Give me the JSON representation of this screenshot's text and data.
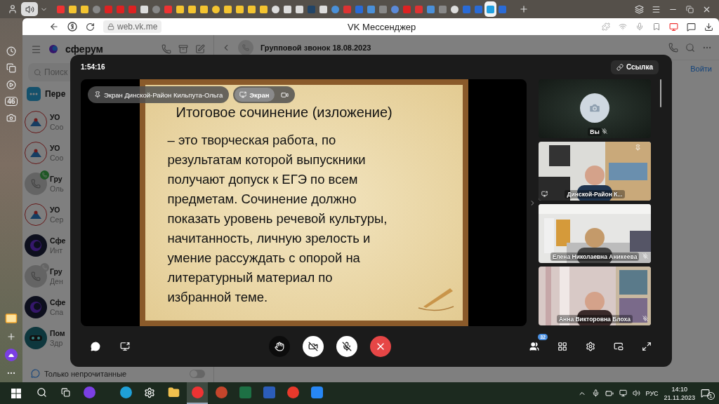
{
  "browser": {
    "tabs": [
      {
        "selected": false
      },
      {
        "selected": false
      },
      {
        "selected": false
      },
      {
        "selected": false
      },
      {
        "selected": false
      },
      {
        "selected": false
      },
      {
        "selected": false
      },
      {
        "selected": false
      },
      {
        "selected": false
      },
      {
        "selected": false
      },
      {
        "selected": false
      },
      {
        "selected": false
      },
      {
        "selected": false
      },
      {
        "selected": false
      },
      {
        "selected": false
      },
      {
        "selected": false
      },
      {
        "selected": false
      },
      {
        "selected": false
      },
      {
        "selected": false
      },
      {
        "selected": false
      },
      {
        "selected": false
      },
      {
        "selected": false
      },
      {
        "selected": false
      },
      {
        "selected": false
      },
      {
        "selected": false
      },
      {
        "selected": false
      },
      {
        "selected": false
      },
      {
        "selected": false
      },
      {
        "selected": false
      },
      {
        "selected": false
      },
      {
        "selected": false
      },
      {
        "selected": false
      },
      {
        "selected": false
      },
      {
        "selected": false
      },
      {
        "selected": false
      },
      {
        "selected": false
      },
      {
        "selected": true
      },
      {
        "selected": false
      }
    ],
    "address": "web.vk.me",
    "page_title": "VK Мессенджер"
  },
  "browser_sidebar": {
    "badge": "46"
  },
  "app": {
    "brand": "сферум",
    "search": {
      "placeholder": "Поиск"
    },
    "pinned": "Пере",
    "chats": [
      {
        "name": "УО",
        "preview": "Соо",
        "kind": "emblem"
      },
      {
        "name": "УО",
        "preview": "Соо",
        "kind": "emblem"
      },
      {
        "name": "Гру",
        "preview": "Оль",
        "kind": "call",
        "active": true
      },
      {
        "name": "УО",
        "preview": "Сер",
        "kind": "emblem"
      },
      {
        "name": "Сфе",
        "preview": "Инт",
        "kind": "brand"
      },
      {
        "name": "Гру",
        "preview": "Ден",
        "kind": "call",
        "active": false
      },
      {
        "name": "Сфе",
        "preview": "Спа",
        "kind": "brand"
      },
      {
        "name": "Пом",
        "preview": "Здр",
        "kind": "bot"
      }
    ],
    "filter": {
      "label": "Только непрочитанные",
      "on": false
    },
    "chat_title": "Групповой звонок 18.08.2023",
    "join": "Войти"
  },
  "call": {
    "timer": "1:54:16",
    "link_button": "Ссылка",
    "stage": {
      "pin_label": "Экран Динской-Район Кильпута-Ольга",
      "views": [
        {
          "kind": "screen",
          "label": "Экран",
          "selected": true
        },
        {
          "kind": "camera",
          "selected": false
        }
      ],
      "slide": {
        "title": "Итоговое сочинение (изложение)",
        "lines": [
          "– это творческая работа, по",
          "результатам которой выпускники",
          "получают допуск к ЕГЭ по всем",
          "предметам. Сочинение должно",
          "показать уровень речевой культуры,",
          "начитанность, личную зрелость и",
          "умение рассуждать с опорой на",
          "литературный материал по",
          "избранной теме."
        ]
      }
    },
    "participants": [
      {
        "name": "Вы",
        "kind": "self",
        "muted": true,
        "pinned": false,
        "sharing": false
      },
      {
        "name": "Динской-Район К...",
        "kind": "video",
        "muted": false,
        "pinned": true,
        "sharing": true
      },
      {
        "name": "Елена Николаевна Аникеева",
        "kind": "video",
        "muted": true,
        "pinned": false,
        "sharing": false
      },
      {
        "name": "Анна Викторовна Блоха",
        "kind": "video",
        "muted": true,
        "pinned": false,
        "sharing": false
      }
    ],
    "controls": {
      "participants_count": "32",
      "hand_raised": false,
      "camera_on": false,
      "mic_on": false
    }
  },
  "taskbar": {
    "apps": [
      {
        "kind": "edge",
        "selected": false
      },
      {
        "kind": "settings",
        "selected": false
      },
      {
        "kind": "explorer",
        "selected": false
      },
      {
        "kind": "yabrowser",
        "selected": true
      },
      {
        "kind": "powerpoint",
        "selected": false
      },
      {
        "kind": "excel",
        "selected": false
      },
      {
        "kind": "word",
        "selected": false
      },
      {
        "kind": "yandex",
        "selected": false
      },
      {
        "kind": "mail",
        "selected": false
      }
    ],
    "lang": "РУС",
    "time": "14:10",
    "date": "21.11.2023",
    "notifications": "1"
  }
}
